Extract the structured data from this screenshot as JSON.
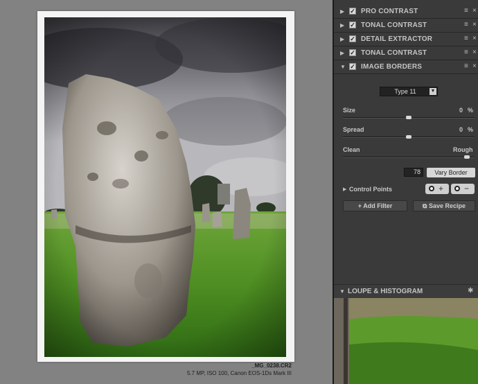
{
  "photo": {
    "filename": "_MG_0238.CR2",
    "meta": "5.7 MP, ISO 100, Canon EOS-1Ds Mark III"
  },
  "filters": [
    {
      "name": "PRO CONTRAST",
      "checked": true,
      "expanded": false
    },
    {
      "name": "TONAL CONTRAST",
      "checked": true,
      "expanded": false
    },
    {
      "name": "DETAIL EXTRACTOR",
      "checked": true,
      "expanded": false
    },
    {
      "name": "TONAL CONTRAST",
      "checked": true,
      "expanded": false
    },
    {
      "name": "IMAGE BORDERS",
      "checked": true,
      "expanded": true
    }
  ],
  "image_borders": {
    "type": "Type 11",
    "size_label": "Size",
    "size_value": "0",
    "spread_label": "Spread",
    "spread_value": "0",
    "unit": "%",
    "clean_label": "Clean",
    "rough_label": "Rough",
    "clean_rough_level": 0.94,
    "seed_value": "78",
    "vary_border_label": "Vary Border"
  },
  "control_points": {
    "label": "Control Points",
    "add_symbol": "+",
    "remove_symbol": "−"
  },
  "actions": {
    "add_filter": "Add Filter",
    "save_recipe": "Save Recipe",
    "add_filter_icon": "+"
  },
  "loupe": {
    "title": "LOUPE & HISTOGRAM"
  },
  "icons": {
    "checkmark": "✓",
    "collapsed": "▶",
    "expanded": "▼",
    "menu": "≡",
    "close": "×",
    "pin": "✱"
  },
  "colors": {
    "panel_bg": "#3a3a3a",
    "canvas_bg": "#828282",
    "frame": "#f4f4f4"
  }
}
